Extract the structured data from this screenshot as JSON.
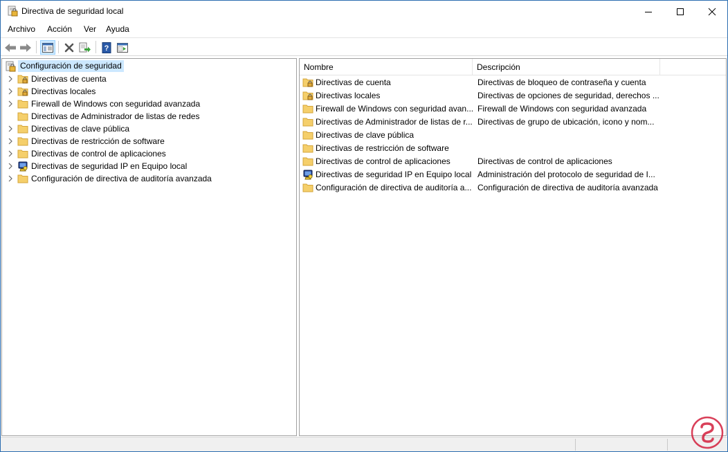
{
  "window": {
    "title": "Directiva de seguridad local",
    "controls": {
      "minimize": "minimize",
      "maximize": "maximize",
      "close": "close"
    }
  },
  "menu": {
    "items": [
      {
        "label": "Archivo"
      },
      {
        "label": "Acción"
      },
      {
        "label": "Ver"
      },
      {
        "label": "Ayuda"
      }
    ]
  },
  "toolbar": {
    "buttons": [
      "back-icon",
      "forward-icon",
      "show-hide-console-tree-icon",
      "delete-icon",
      "export-list-icon",
      "help-icon",
      "properties-icon"
    ]
  },
  "tree": {
    "root": {
      "label": "Configuración de seguridad",
      "selected": true
    },
    "items": [
      {
        "label": "Directivas de cuenta",
        "icon": "folder-lock-icon",
        "expandable": true
      },
      {
        "label": "Directivas locales",
        "icon": "folder-lock-icon",
        "expandable": true
      },
      {
        "label": "Firewall de Windows con seguridad avanzada",
        "icon": "folder-icon",
        "expandable": true
      },
      {
        "label": "Directivas de Administrador de listas de redes",
        "icon": "folder-icon",
        "expandable": false
      },
      {
        "label": "Directivas de clave pública",
        "icon": "folder-icon",
        "expandable": true
      },
      {
        "label": "Directivas de restricción de software",
        "icon": "folder-icon",
        "expandable": true
      },
      {
        "label": "Directivas de control de aplicaciones",
        "icon": "folder-icon",
        "expandable": true
      },
      {
        "label": "Directivas de seguridad IP en Equipo local",
        "icon": "ipsec-icon",
        "expandable": true
      },
      {
        "label": "Configuración de directiva de auditoría avanzada",
        "icon": "folder-icon",
        "expandable": true
      }
    ]
  },
  "list": {
    "columns": {
      "name": "Nombre",
      "description": "Descripción"
    },
    "rows": [
      {
        "name": "Directivas de cuenta",
        "description": "Directivas de bloqueo de contraseña y cuenta",
        "icon": "folder-lock-icon"
      },
      {
        "name": "Directivas locales",
        "description": "Directivas de opciones de seguridad, derechos ...",
        "icon": "folder-lock-icon"
      },
      {
        "name": "Firewall de Windows con seguridad avan...",
        "description": "Firewall de Windows con seguridad avanzada",
        "icon": "folder-icon"
      },
      {
        "name": "Directivas de Administrador de listas de r...",
        "description": "Directivas de grupo de ubicación, icono y nom...",
        "icon": "folder-icon"
      },
      {
        "name": "Directivas de clave pública",
        "description": "",
        "icon": "folder-icon"
      },
      {
        "name": "Directivas de restricción de software",
        "description": "",
        "icon": "folder-icon"
      },
      {
        "name": "Directivas de control de aplicaciones",
        "description": "Directivas de control de aplicaciones",
        "icon": "folder-icon"
      },
      {
        "name": "Directivas de seguridad IP en Equipo local",
        "description": "Administración del protocolo de seguridad de I...",
        "icon": "ipsec-icon"
      },
      {
        "name": "Configuración de directiva de auditoría a...",
        "description": "Configuración de directiva de auditoría avanzada",
        "icon": "folder-icon"
      }
    ]
  },
  "colors": {
    "selection": "#cce8ff",
    "folder": "#f5cf6b",
    "folder_dark": "#e0ab3a",
    "help_blue": "#2a5aa8",
    "arrow_gray": "#8a8a8a",
    "watermark": "#d21f3c"
  }
}
